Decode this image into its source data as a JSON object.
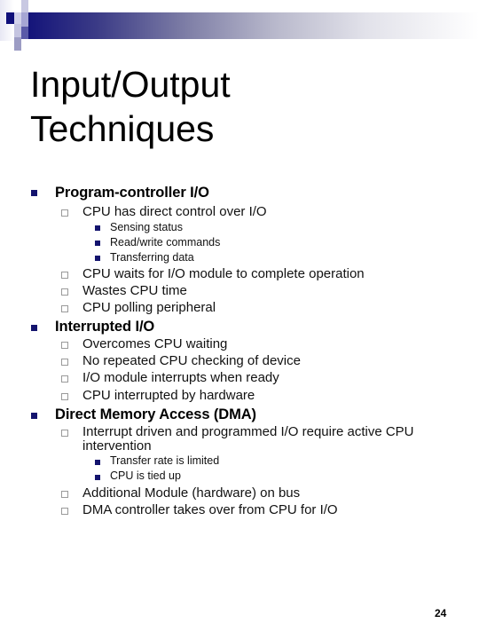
{
  "slide": {
    "title_line1": "Input/Output",
    "title_line2": "Techniques",
    "page_number": "24",
    "colors": {
      "accent_navy": "#14146e",
      "hollow_bullet_border": "#9a9a9a"
    },
    "sections": [
      {
        "heading": "Program-controller I/O",
        "items": [
          {
            "text": "CPU has direct control over I/O",
            "subitems": [
              "Sensing status",
              "Read/write commands",
              "Transferring data"
            ]
          },
          {
            "text": "CPU waits for I/O module to complete operation"
          },
          {
            "text": "Wastes CPU time"
          },
          {
            "text": "CPU polling peripheral"
          }
        ]
      },
      {
        "heading": "Interrupted I/O",
        "items": [
          {
            "text": "Overcomes CPU waiting"
          },
          {
            "text": "No repeated CPU checking of device"
          },
          {
            "text": "I/O module interrupts when ready"
          },
          {
            "text": "CPU interrupted by hardware"
          }
        ]
      },
      {
        "heading": "Direct Memory Access (DMA)",
        "items": [
          {
            "text_line1": "Interrupt driven and programmed I/O require active CPU",
            "text_line2": "intervention",
            "subitems": [
              "Transfer rate is limited",
              "CPU is tied up"
            ]
          },
          {
            "text": "Additional Module (hardware) on bus"
          },
          {
            "text": "DMA controller takes over from CPU for I/O"
          }
        ]
      }
    ]
  }
}
